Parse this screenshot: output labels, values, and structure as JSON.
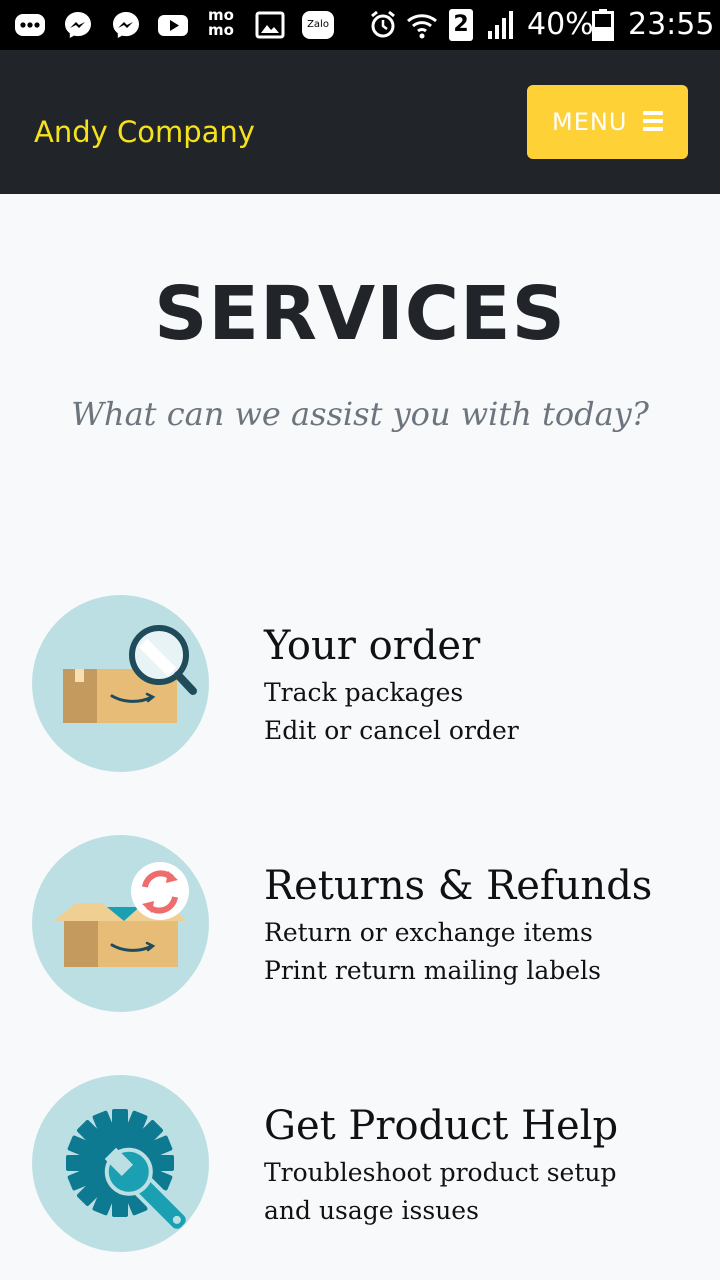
{
  "status_bar": {
    "sim_slot": "2",
    "battery": "40%",
    "time": "23:55",
    "icons": [
      "more-icon",
      "messenger-icon",
      "messenger-icon",
      "youtube-icon",
      "momo-icon",
      "gallery-icon",
      "zalo-icon",
      "alarm-icon",
      "wifi-icon",
      "sim-icon",
      "signal-icon",
      "battery-icon"
    ],
    "notification_labels": {
      "momo": "mo mo",
      "zalo": "Zalo"
    }
  },
  "navbar": {
    "brand": "Andy Company",
    "menu_label": "MENU",
    "menu_icon": "hamburger-icon"
  },
  "header": {
    "title": "SERVICES",
    "subtitle": "What can we assist you with today?"
  },
  "services": [
    {
      "title": "Your order",
      "lines": [
        "Track packages",
        "Edit or cancel order"
      ],
      "icon": "package-search-icon"
    },
    {
      "title": "Returns & Refunds",
      "lines": [
        "Return or exchange items",
        "Print return mailing labels"
      ],
      "icon": "package-return-icon"
    },
    {
      "title": "Get Product Help",
      "lines": [
        "Troubleshoot product setup",
        "and usage issues"
      ],
      "icon": "gear-wrench-icon"
    }
  ],
  "colors": {
    "navbar_bg": "#212529",
    "brand": "#f6e21c",
    "menu_button": "#fed136",
    "icon_circle": "#bcdfe3",
    "heading": "#212529",
    "subheading": "#6c757d"
  }
}
